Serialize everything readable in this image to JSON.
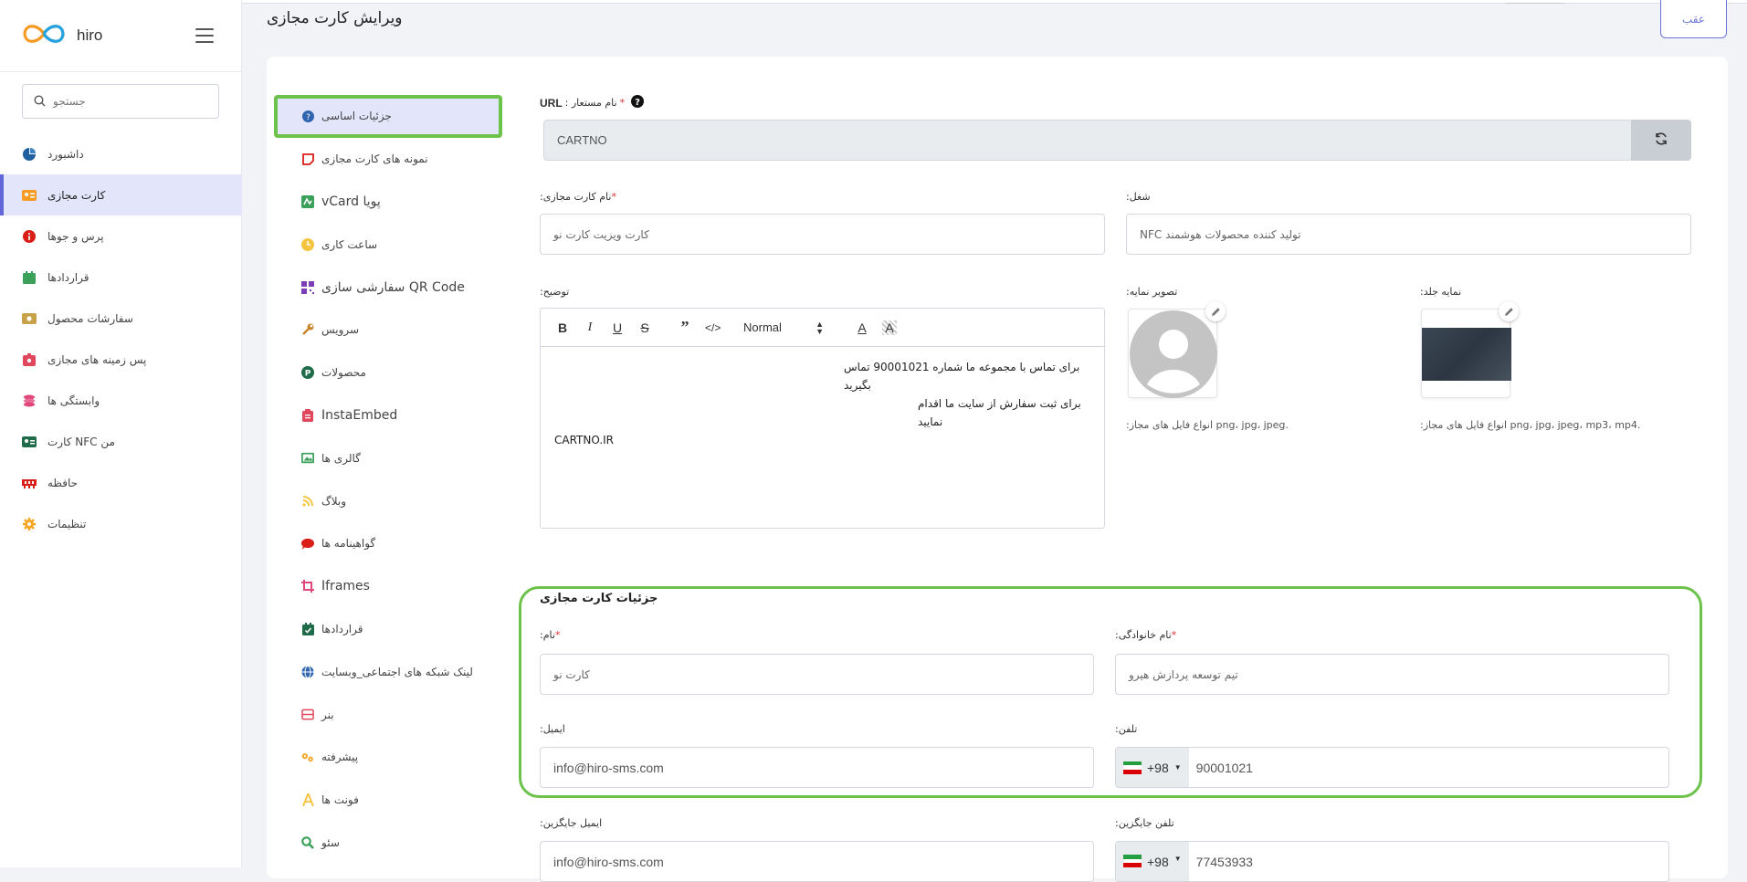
{
  "sidebar": {
    "brand": "hiro",
    "search_placeholder": "جستجو",
    "items": [
      {
        "label": "داشبورد"
      },
      {
        "label": "کارت مجازی"
      },
      {
        "label": "پرس و جوها"
      },
      {
        "label": "قراردادها"
      },
      {
        "label": "سفارشات محصول"
      },
      {
        "label": "پس زمینه های مجازی"
      },
      {
        "label": "وابستگی ها"
      },
      {
        "label": "کارت NFC من"
      },
      {
        "label": "حافظه"
      },
      {
        "label": "تنظیمات"
      }
    ]
  },
  "header": {
    "title": "ویرایش کارت مجازی",
    "back_label": "عقب"
  },
  "tabs": [
    {
      "label": "جزئیات اساسی"
    },
    {
      "label": "نمونه های کارت مجازی"
    },
    {
      "label": "vCard پویا"
    },
    {
      "label": "ساعت کاری"
    },
    {
      "label": "سفارشی سازی QR Code"
    },
    {
      "label": "سرویس"
    },
    {
      "label": "محصولات"
    },
    {
      "label": "InstaEmbed"
    },
    {
      "label": "گالری ها"
    },
    {
      "label": "وبلاگ"
    },
    {
      "label": "گواهینامه ها"
    },
    {
      "label": "Iframes"
    },
    {
      "label": "قراردادها"
    },
    {
      "label": "لینک شبکه های اجتماعی_وبسایت"
    },
    {
      "label": "بنر"
    },
    {
      "label": "پیشرفته"
    },
    {
      "label": "فونت ها"
    },
    {
      "label": "سئو"
    }
  ],
  "form": {
    "url_alias_label": "URL",
    "url_alias_label_fa": ": نام مستعار",
    "url_alias_value": "CARTNO",
    "card_name_label": ":نام کارت مجازی",
    "card_name_placeholder": "کارت ویزیت کارت نو",
    "occupation_label": ":شغل",
    "occupation_value": "NFC تولید کننده محصولات هوشمند",
    "description_label": ":توضیح",
    "editor_format": "Normal",
    "description_lines": [
      "برای تماس با مجموعه ما شماره 90001021 تماس بگیرید",
      "برای ثبت سفارش از سایت ما اقدام نمایید",
      "CARTNO.IR"
    ],
    "profile_image_label": ":تصویر نمایه",
    "profile_hint": ":انواع فایل های مجاز png، jpg، jpeg.",
    "cover_image_label": ":نمایه جلد",
    "cover_hint": ":انواع فایل های مجاز png، jpg، jpeg، mp3، mp4."
  },
  "details": {
    "title": "جزئیات کارت مجازی",
    "first_name_label": ":نام",
    "first_name_placeholder": "کارت نو",
    "last_name_label": ":نام خانوادگی",
    "last_name_placeholder": "تیم توسعه پردازش هیرو",
    "email_label": ":ایمیل",
    "email_value": "info@hiro-sms.com",
    "phone_label": ":تلفن",
    "phone_code": "+98",
    "phone_value": "90001021",
    "alt_email_label": ":ایمیل جایگزین",
    "alt_email_value": "info@hiro-sms.com",
    "alt_phone_label": ":تلفن جایگزین",
    "alt_phone_code": "+98",
    "alt_phone_value": "77453933"
  }
}
